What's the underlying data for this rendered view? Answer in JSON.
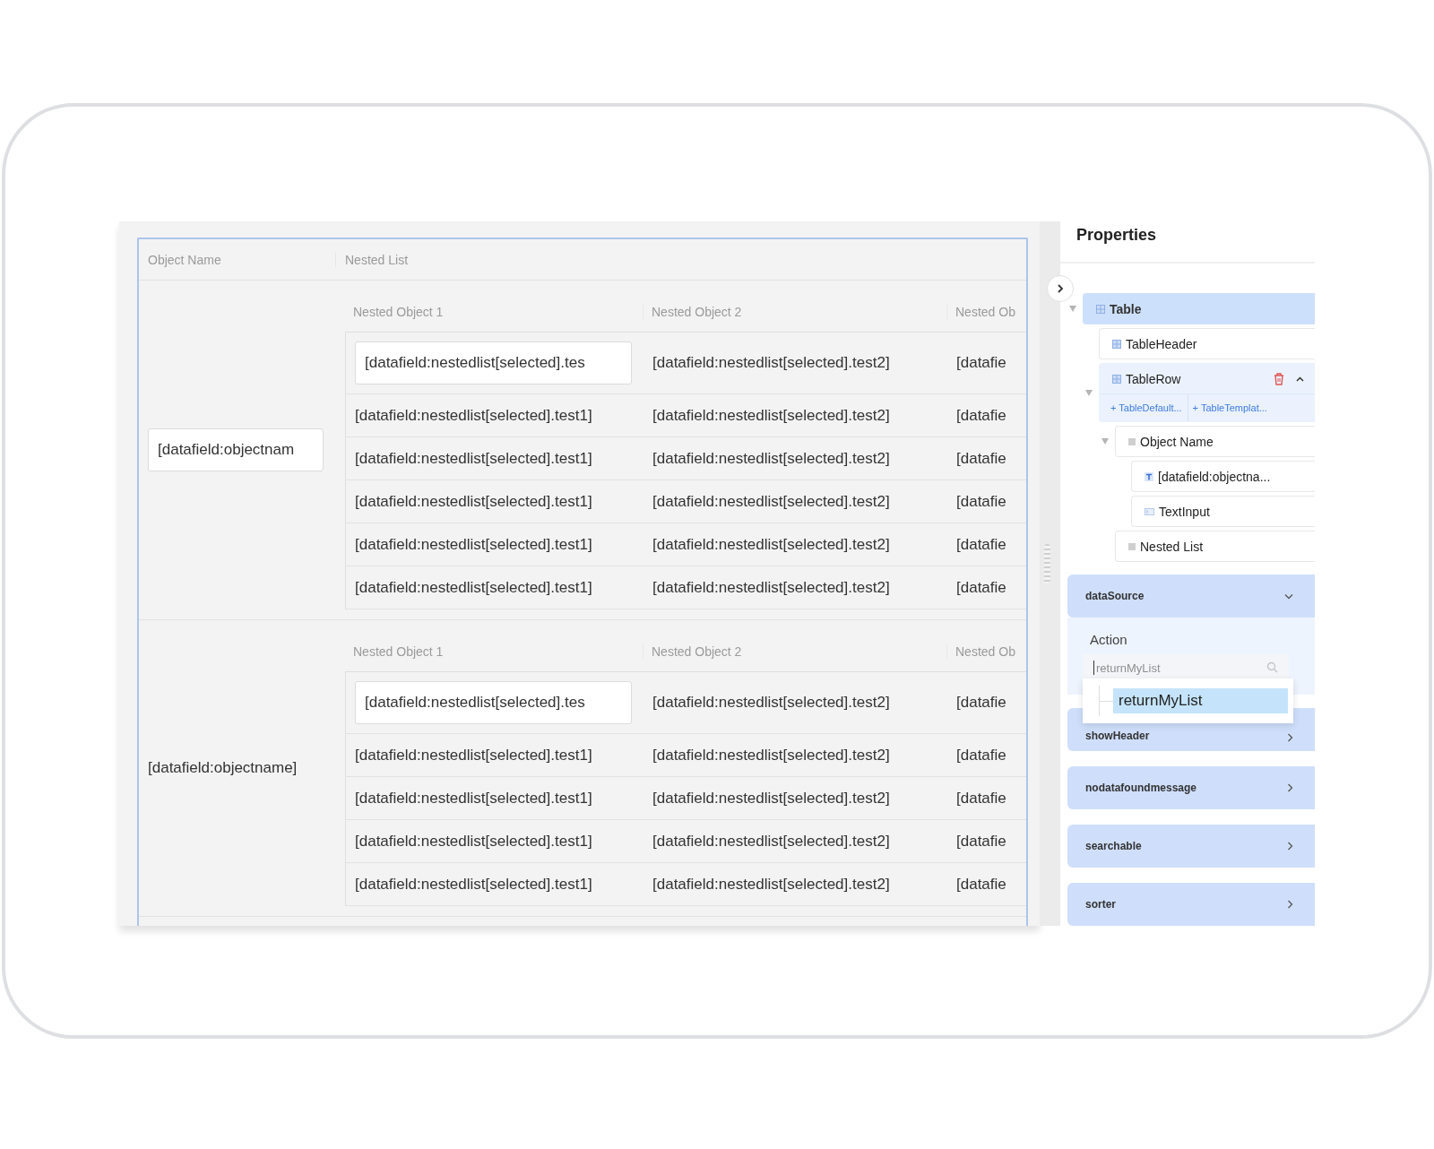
{
  "canvas": {
    "table": {
      "columns": [
        "Object Name",
        "Nested List"
      ],
      "rows": [
        {
          "object_name": {
            "kind": "input",
            "value": "[datafield:objectnam"
          },
          "nested": {
            "columns": [
              "Nested Object 1",
              "Nested Object 2",
              "Nested Ob"
            ],
            "rows": [
              [
                {
                  "kind": "input",
                  "value": "[datafield:nestedlist[selected].tes"
                },
                {
                  "kind": "text",
                  "value": "[datafield:nestedlist[selected].test2]"
                },
                {
                  "kind": "text",
                  "value": "[datafie"
                }
              ],
              [
                {
                  "kind": "text",
                  "value": "[datafield:nestedlist[selected].test1]"
                },
                {
                  "kind": "text",
                  "value": "[datafield:nestedlist[selected].test2]"
                },
                {
                  "kind": "text",
                  "value": "[datafie"
                }
              ],
              [
                {
                  "kind": "text",
                  "value": "[datafield:nestedlist[selected].test1]"
                },
                {
                  "kind": "text",
                  "value": "[datafield:nestedlist[selected].test2]"
                },
                {
                  "kind": "text",
                  "value": "[datafie"
                }
              ],
              [
                {
                  "kind": "text",
                  "value": "[datafield:nestedlist[selected].test1]"
                },
                {
                  "kind": "text",
                  "value": "[datafield:nestedlist[selected].test2]"
                },
                {
                  "kind": "text",
                  "value": "[datafie"
                }
              ],
              [
                {
                  "kind": "text",
                  "value": "[datafield:nestedlist[selected].test1]"
                },
                {
                  "kind": "text",
                  "value": "[datafield:nestedlist[selected].test2]"
                },
                {
                  "kind": "text",
                  "value": "[datafie"
                }
              ],
              [
                {
                  "kind": "text",
                  "value": "[datafield:nestedlist[selected].test1]"
                },
                {
                  "kind": "text",
                  "value": "[datafield:nestedlist[selected].test2]"
                },
                {
                  "kind": "text",
                  "value": "[datafie"
                }
              ]
            ]
          }
        },
        {
          "object_name": {
            "kind": "text",
            "value": "[datafield:objectname]"
          },
          "nested": {
            "columns": [
              "Nested Object 1",
              "Nested Object 2",
              "Nested Ob"
            ],
            "rows": [
              [
                {
                  "kind": "input",
                  "value": "[datafield:nestedlist[selected].tes"
                },
                {
                  "kind": "text",
                  "value": "[datafield:nestedlist[selected].test2]"
                },
                {
                  "kind": "text",
                  "value": "[datafie"
                }
              ],
              [
                {
                  "kind": "text",
                  "value": "[datafield:nestedlist[selected].test1]"
                },
                {
                  "kind": "text",
                  "value": "[datafield:nestedlist[selected].test2]"
                },
                {
                  "kind": "text",
                  "value": "[datafie"
                }
              ],
              [
                {
                  "kind": "text",
                  "value": "[datafield:nestedlist[selected].test1]"
                },
                {
                  "kind": "text",
                  "value": "[datafield:nestedlist[selected].test2]"
                },
                {
                  "kind": "text",
                  "value": "[datafie"
                }
              ],
              [
                {
                  "kind": "text",
                  "value": "[datafield:nestedlist[selected].test1]"
                },
                {
                  "kind": "text",
                  "value": "[datafield:nestedlist[selected].test2]"
                },
                {
                  "kind": "text",
                  "value": "[datafie"
                }
              ],
              [
                {
                  "kind": "text",
                  "value": "[datafield:nestedlist[selected].test1]"
                },
                {
                  "kind": "text",
                  "value": "[datafield:nestedlist[selected].test2]"
                },
                {
                  "kind": "text",
                  "value": "[datafie"
                }
              ]
            ]
          }
        }
      ]
    }
  },
  "properties": {
    "title": "Properties",
    "tree": [
      {
        "label": "Table",
        "kind": "table",
        "selected": true,
        "expanded": true,
        "children": [
          {
            "label": "TableHeader",
            "kind": "table",
            "selected": false
          },
          {
            "label": "TableRow",
            "kind": "table",
            "selected": false,
            "expanded": true,
            "deletable": true,
            "slots": [
              "+ TableDefault...",
              "+ TableTemplat..."
            ],
            "children": [
              {
                "label": "Object Name",
                "kind": "column",
                "selected": false,
                "expanded": true,
                "children": [
                  {
                    "label": "[datafield:objectna...",
                    "kind": "text",
                    "selected": false
                  },
                  {
                    "label": "TextInput",
                    "kind": "input",
                    "selected": false
                  }
                ]
              },
              {
                "label": "Nested List",
                "kind": "column",
                "selected": false
              }
            ]
          }
        ]
      }
    ],
    "sections": [
      {
        "label": "dataSource",
        "expanded": true,
        "field_label": "Action",
        "search": {
          "placeholder": "returnMyList"
        },
        "options": [
          {
            "label": "returnMyList",
            "selected": true
          }
        ]
      },
      {
        "label": "showHeader",
        "expanded": false
      },
      {
        "label": "nodatafoundmessage",
        "expanded": false
      },
      {
        "label": "searchable",
        "expanded": false
      },
      {
        "label": "sorter",
        "expanded": false
      }
    ]
  }
}
